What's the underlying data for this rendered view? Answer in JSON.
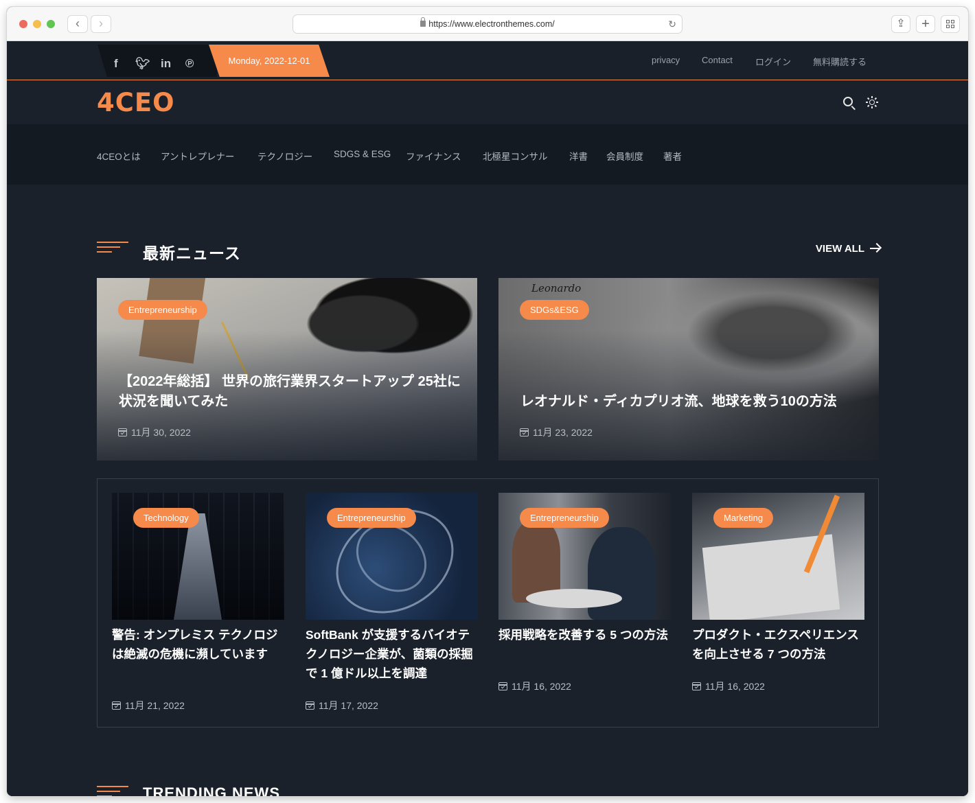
{
  "browser": {
    "url": "https://www.electronthemes.com/",
    "icons": [
      "back-icon",
      "forward-icon",
      "lock-icon",
      "reload-icon",
      "share-icon",
      "new-tab-icon",
      "tab-overview-icon"
    ]
  },
  "topbar": {
    "date": "Monday, 2022-12-01",
    "social_icons": [
      "facebook-icon",
      "twitter-icon",
      "linkedin-icon",
      "pinterest-icon"
    ],
    "links": [
      "privacy",
      "Contact",
      "ログイン",
      "無料購読する"
    ]
  },
  "brand": {
    "logo": "4CEO"
  },
  "menu": [
    "4CEOとは",
    "アントレプレナー",
    "テクノロジー",
    "SDGS & ESG",
    "ファイナンス",
    "北極星コンサル",
    "洋書",
    "会員制度",
    "著者"
  ],
  "latest": {
    "title": "最新ニュース",
    "view_all": "VIEW ALL",
    "featured": [
      {
        "tag": "Entrepreneurship",
        "title": "【2022年総括】 世界の旅行業界スタートアップ 25社に状況を聞いてみた",
        "date": "11月 30, 2022"
      },
      {
        "tag": "SDGs&ESG",
        "title": "レオナルド・ディカプリオ流、地球を救う10の方法",
        "date": "11月 23, 2022",
        "image_text": "Leonardo"
      }
    ],
    "cards": [
      {
        "tag": "Technology",
        "title": "警告: オンプレミス テクノロジは絶滅の危機に瀕しています",
        "date": "11月 21, 2022"
      },
      {
        "tag": "Entrepreneurship",
        "title": "SoftBank が支援するバイオテクノロジー企業が、菌類の採掘で 1 億ドル以上を調達",
        "date": "11月 17, 2022"
      },
      {
        "tag": "Entrepreneurship",
        "title": "採用戦略を改善する 5 つの方法",
        "date": "11月 16, 2022"
      },
      {
        "tag": "Marketing",
        "title": "プロダクト・エクスペリエンスを向上させる 7 つの方法",
        "date": "11月 16, 2022"
      }
    ]
  },
  "trending": {
    "title": "TRENDING NEWS"
  },
  "colors": {
    "accent": "#f58a4b",
    "background": "#1b212b",
    "menu_background": "#141a22"
  }
}
